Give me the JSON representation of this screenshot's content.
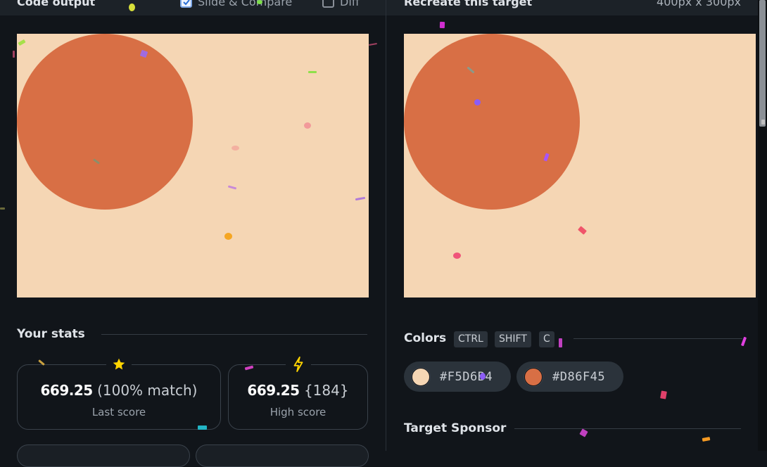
{
  "output_panel": {
    "title": "Code output",
    "slide_compare_label": "Slide & Compare",
    "slide_compare_checked": true,
    "diff_label": "Diff",
    "diff_checked": false
  },
  "target_panel": {
    "title": "Recreate this target",
    "size_label": "400px x 300px"
  },
  "canvas": {
    "background": "#F5D6B4",
    "circle_color": "#D86F45"
  },
  "stats": {
    "title": "Your stats",
    "last": {
      "score": "669.25",
      "detail": "(100% match)",
      "label": "Last score",
      "icon": "star-icon"
    },
    "high": {
      "score": "669.25",
      "detail": "{184}",
      "label": "High score",
      "icon": "lightning-icon"
    }
  },
  "colors": {
    "title": "Colors",
    "shortcut_keys": [
      "CTRL",
      "SHIFT",
      "C"
    ],
    "swatches": [
      {
        "hex": "#F5D6B4",
        "label": "#F5D6B4"
      },
      {
        "hex": "#D86F45",
        "label": "#D86F45"
      }
    ]
  },
  "sponsor": {
    "title": "Target Sponsor"
  },
  "theme": {
    "background": "#11151a",
    "accent_check": "#7fa9e8",
    "star": "#ffd400"
  }
}
